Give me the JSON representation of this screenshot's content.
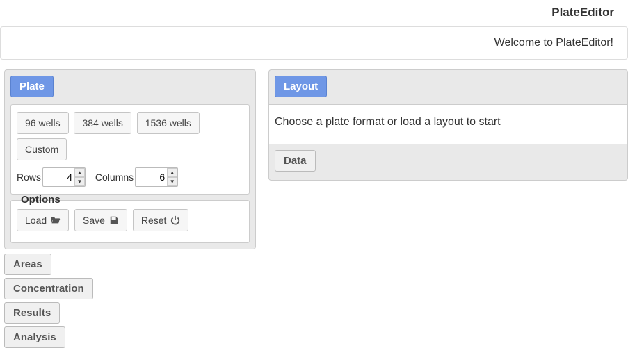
{
  "header": {
    "title": "PlateEditor"
  },
  "welcome": "Welcome to PlateEditor!",
  "left": {
    "active_tab": "Plate",
    "format_buttons": [
      "96 wells",
      "384 wells",
      "1536 wells",
      "Custom"
    ],
    "rows_label": "Rows",
    "rows_value": "4",
    "cols_label": "Columns",
    "cols_value": "6",
    "options_legend": "Options",
    "load_label": "Load",
    "save_label": "Save",
    "reset_label": "Reset",
    "tabs": [
      "Areas",
      "Concentration",
      "Results",
      "Analysis"
    ]
  },
  "right": {
    "active_tab": "Layout",
    "body_text": "Choose a plate format or load a layout to start",
    "data_tab": "Data"
  }
}
